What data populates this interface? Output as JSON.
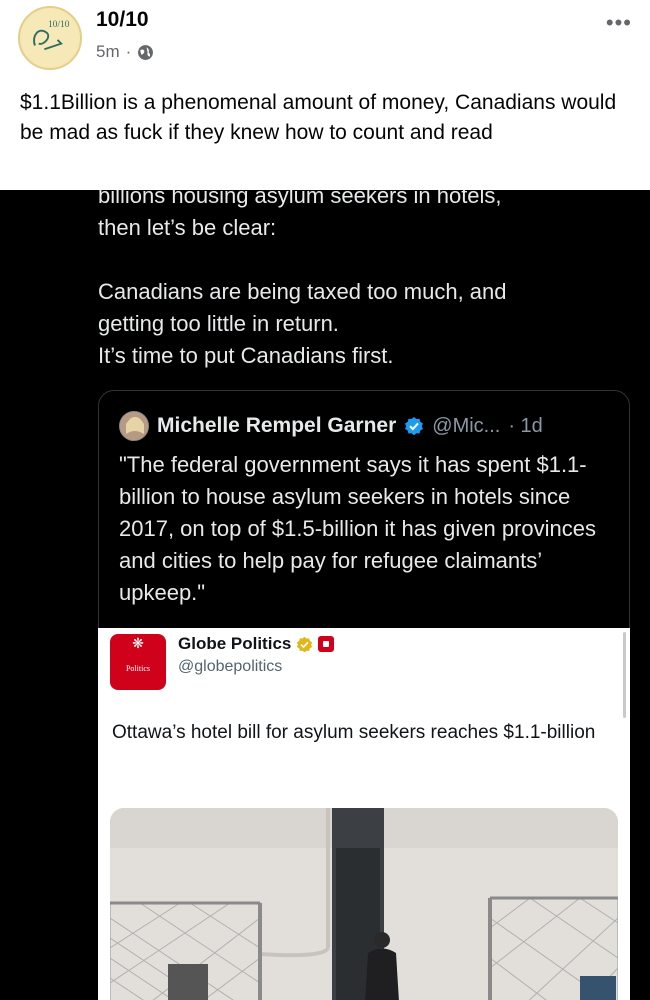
{
  "post": {
    "author": "10/10",
    "time": "5m",
    "separator": "·",
    "more_label": "•••",
    "avatar_text": "10/10",
    "text": "$1.1Billion is a phenomenal amount of money, Canadians would be mad as fuck if they knew how to count and read"
  },
  "tweet": {
    "lines": [
      "billions housing asylum seekers in hotels,",
      "then let’s be clear:",
      "",
      "Canadians are being taxed too much, and",
      "getting too little in return.",
      "It’s time to put Canadians first."
    ]
  },
  "quote": {
    "name": "Michelle Rempel Garner",
    "handle": "@Mic...",
    "time": "· 1d",
    "text": "\"The federal government says it has spent $1.1-billion to house asylum seekers in hotels since 2017, on top of $1.5-billion it has given provinces and cities to help pay for refugee claimants’ upkeep.\""
  },
  "globe_card": {
    "name": "Globe Politics",
    "handle": "@globepolitics",
    "logo_text": "Politics",
    "headline": "Ottawa’s hotel bill for asylum seekers reaches $1.1-billion"
  },
  "colors": {
    "dark_bg": "#000000",
    "accent_red": "#d0021b",
    "verified_blue": "#1d9bf0",
    "verified_gold": "#e2b719"
  },
  "icons": [
    "globe-icon",
    "more-icon",
    "verified-badge-icon",
    "gold-verified-badge-icon",
    "maple-leaf-icon",
    "canada-flag-icon"
  ]
}
